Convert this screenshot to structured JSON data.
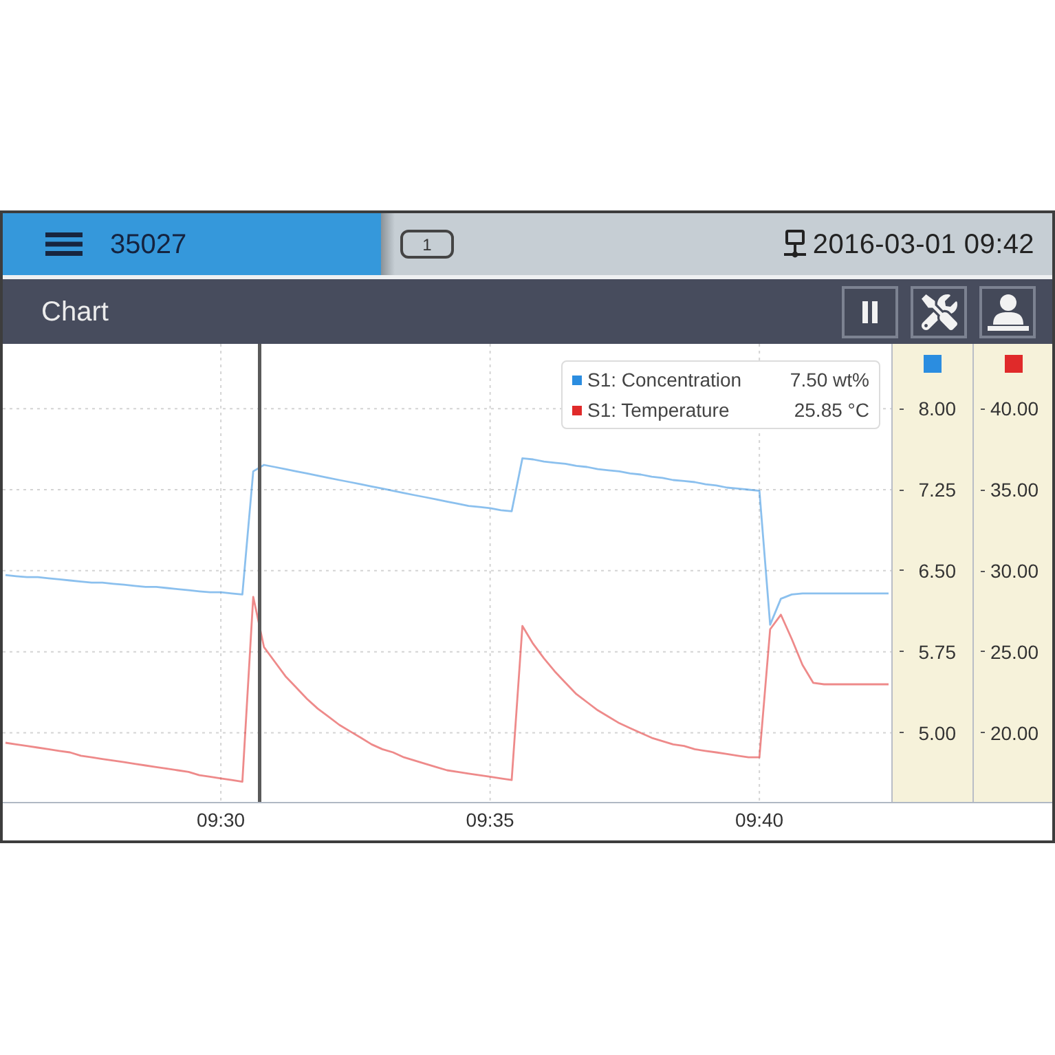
{
  "top_bar": {
    "device_id": "35027",
    "badge": "1",
    "datetime": "2016-03-01 09:42"
  },
  "title_bar": {
    "title": "Chart",
    "buttons": [
      {
        "kind": "pause"
      },
      {
        "kind": "tools"
      },
      {
        "kind": "user"
      }
    ]
  },
  "chart": {
    "legend_values": [
      "7.50 wt%",
      "25.85 °C"
    ],
    "chart_data": {
      "type": "line",
      "grid": true,
      "legend": true,
      "categories": [
        null,
        null,
        null,
        null,
        null,
        null,
        null,
        null,
        null,
        null,
        null,
        null,
        null,
        null,
        null,
        null,
        null,
        null,
        null,
        null,
        "09:30",
        null,
        null,
        null,
        null,
        null,
        null,
        null,
        null,
        null,
        null,
        null,
        null,
        null,
        null,
        null,
        null,
        null,
        null,
        null,
        null,
        null,
        null,
        null,
        null,
        "09:35",
        null,
        null,
        null,
        null,
        null,
        null,
        null,
        null,
        null,
        null,
        null,
        null,
        null,
        null,
        null,
        null,
        null,
        null,
        null,
        null,
        null,
        null,
        null,
        null,
        "09:40",
        null,
        null,
        null,
        null,
        null,
        null,
        null,
        null,
        null,
        null,
        null,
        null
      ],
      "ylim": [
        4.36,
        8.6
      ],
      "yticks": [
        {
          "value": 8,
          "label": "8.00"
        },
        {
          "value": 7.25,
          "label": "7.25"
        },
        {
          "value": 6.5,
          "label": "6.50"
        },
        {
          "value": 5.75,
          "label": "5.75"
        },
        {
          "value": 5,
          "label": "5.00"
        }
      ],
      "y2lim": [
        15.75,
        44.0
      ],
      "y2ticks": [
        {
          "value": 40,
          "label": "40.00"
        },
        {
          "value": 35,
          "label": "35.00"
        },
        {
          "value": 30,
          "label": "30.00"
        },
        {
          "value": 25,
          "label": "25.00"
        },
        {
          "value": 20,
          "label": "20.00"
        }
      ],
      "series": [
        {
          "name": "S1: Concentration",
          "color": "#2b8de0",
          "axis": "y",
          "values": [
            6.46,
            6.45,
            6.44,
            6.44,
            6.43,
            6.42,
            6.41,
            6.4,
            6.39,
            6.39,
            6.38,
            6.37,
            6.36,
            6.35,
            6.35,
            6.34,
            6.33,
            6.32,
            6.31,
            6.3,
            6.3,
            6.29,
            6.28,
            7.42,
            7.48,
            7.46,
            7.44,
            7.42,
            7.4,
            7.38,
            7.36,
            7.34,
            7.32,
            7.3,
            7.28,
            7.26,
            7.24,
            7.22,
            7.2,
            7.18,
            7.16,
            7.14,
            7.12,
            7.1,
            7.09,
            7.08,
            7.06,
            7.05,
            7.54,
            7.53,
            7.51,
            7.5,
            7.49,
            7.47,
            7.46,
            7.44,
            7.43,
            7.42,
            7.4,
            7.39,
            7.37,
            7.36,
            7.34,
            7.33,
            7.32,
            7.3,
            7.29,
            7.27,
            7.26,
            7.25,
            7.24,
            6.0,
            6.24,
            6.28,
            6.29,
            6.29,
            6.29,
            6.29,
            6.29,
            6.29,
            6.29,
            6.29,
            6.29
          ]
        },
        {
          "name": "S1: Temperature",
          "color": "#e02a2a",
          "axis": "y2",
          "values": [
            19.4,
            19.3,
            19.2,
            19.1,
            19.0,
            18.9,
            18.8,
            18.6,
            18.5,
            18.4,
            18.3,
            18.2,
            18.1,
            18.0,
            17.9,
            17.8,
            17.7,
            17.6,
            17.4,
            17.3,
            17.2,
            17.1,
            17.0,
            28.4,
            25.3,
            24.4,
            23.5,
            22.8,
            22.1,
            21.5,
            21.0,
            20.5,
            20.1,
            19.7,
            19.3,
            19.0,
            18.8,
            18.5,
            18.3,
            18.1,
            17.9,
            17.7,
            17.6,
            17.5,
            17.4,
            17.3,
            17.2,
            17.1,
            26.6,
            25.5,
            24.6,
            23.8,
            23.1,
            22.4,
            21.9,
            21.4,
            21.0,
            20.6,
            20.3,
            20.0,
            19.7,
            19.5,
            19.3,
            19.2,
            19.0,
            18.9,
            18.8,
            18.7,
            18.6,
            18.5,
            18.5,
            26.4,
            27.3,
            25.8,
            24.2,
            23.1,
            23.0,
            23.0,
            23.0,
            23.0,
            23.0,
            23.0,
            23.0
          ]
        }
      ]
    }
  }
}
